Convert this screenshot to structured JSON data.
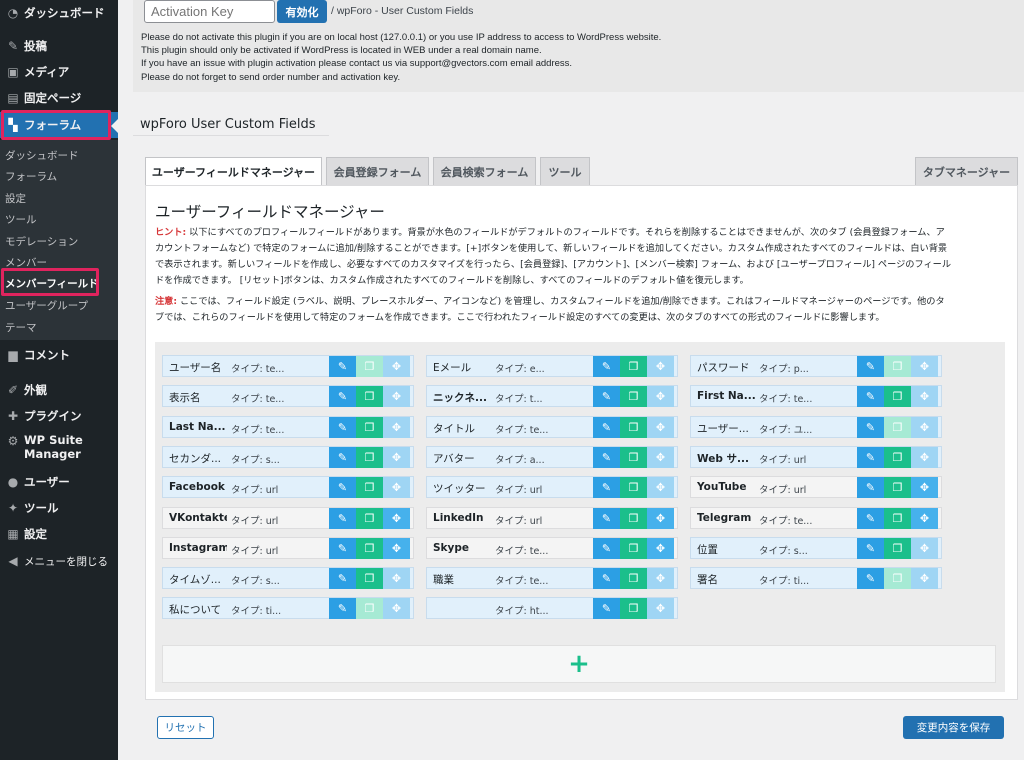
{
  "sidebar": {
    "menu": {
      "dashboard": "ダッシュボード",
      "posts": "投稿",
      "media": "メディア",
      "pages": "固定ページ",
      "forum": "フォーラム",
      "comments": "コメント",
      "appearance": "外観",
      "plugins": "プラグイン",
      "wp_suite_line1": "WP Suite",
      "wp_suite_line2": "Manager",
      "users": "ユーザー",
      "tools": "ツール",
      "settings": "設定",
      "collapse": "メニューを閉じる"
    },
    "submenu": {
      "dashboard": "ダッシュボード",
      "forums": "フォーラム",
      "settings": "設定",
      "tools": "ツール",
      "moderation": "モデレーション",
      "members": "メンバー",
      "member_fields": "メンバーフィールド",
      "usergroups": "ユーザーグループ",
      "themes": "テーマ"
    },
    "highlight_color": "#e0245e"
  },
  "notice": {
    "activation_placeholder": "Activation Key",
    "activate_label": "有効化",
    "plugin_name": "/ wpForo - User Custom Fields",
    "lines": [
      "Please do not activate this plugin if you are on local host (127.0.0.1) or you use IP address to access to WordPress website.",
      "This plugin should only be activated if WordPress is located in WEB under a real domain name.",
      "If you have an issue with plugin activation please contact us via support@gvectors.com email address.",
      "Please do not forget to send order number and activation key."
    ]
  },
  "page": {
    "heading": "wpForo User Custom Fields",
    "tabs": {
      "field_manager": "ユーザーフィールドマネージャー",
      "register_form": "会員登録フォーム",
      "search_form": "会員検索フォーム",
      "tools": "ツール",
      "tab_manager": "タブマネージャー"
    },
    "panel_title": "ユーザーフィールドマネージャー",
    "hint_lead": "ヒント:",
    "hint_lines": [
      "以下にすべてのプロフィールフィールドがあります。背景が水色のフィールドがデフォルトのフィールドです。それらを削除することはできませんが、次のタブ (会員登録フォーム、ア",
      "カウントフォームなど) で特定のフォームに追加/削除することができます。[+]ボタンを使用して、新しいフィールドを追加してください。カスタム作成されたすべてのフィールドは、白い背景",
      "で表示されます。新しいフィールドを作成し、必要なすべてのカスタマイズを行ったら、[会員登録]、[アカウント]、[メンバー検索] フォーム、および [ユーザープロフィール] ページのフィール",
      "ドを作成できます。 [リセット]ボタンは、カスタム作成されたすべてのフィールドを削除し、すべてのフィールドのデフォルト値を復元します。"
    ],
    "note_lead": "注意:",
    "note_lines": [
      "ここでは、フィールド設定 (ラベル、説明、プレースホルダー、アイコンなど) を管理し、カスタムフィールドを追加/削除できます。これはフィールドマネージャーのページです。他のタ",
      "ブでは、これらのフィールドを使用して特定のフォームを作成できます。ここで行われたフィールド設定のすべての変更は、次のタブのすべての形式のフィールドに影響します。"
    ],
    "fields": [
      [
        {
          "label": "ユーザー名",
          "type": "タイプ: te...",
          "dup": "light",
          "move": "light"
        },
        {
          "label": "表示名",
          "type": "タイプ: te...",
          "dup": "normal",
          "move": "light"
        },
        {
          "label": "Last Na...",
          "type": "タイプ: te...",
          "dup": "normal",
          "move": "light",
          "bold": true
        },
        {
          "label": "セカンダ...",
          "type": "タイプ: s...",
          "dup": "normal",
          "move": "light"
        },
        {
          "label": "Facebook",
          "type": "タイプ: url",
          "dup": "normal",
          "move": "light",
          "bold": true
        },
        {
          "label": "VKontakte",
          "type": "タイプ: url",
          "dup": "normal",
          "move": "normal",
          "bold": true,
          "custom": true
        },
        {
          "label": "Instagram",
          "type": "タイプ: url",
          "dup": "normal",
          "move": "normal",
          "bold": true,
          "custom": true
        },
        {
          "label": "タイムゾ...",
          "type": "タイプ: s...",
          "dup": "normal",
          "move": "light"
        },
        {
          "label": "私について",
          "type": "タイプ: ti...",
          "dup": "light",
          "move": "light"
        }
      ],
      [
        {
          "label": "Eメール",
          "type": "タイプ: e...",
          "dup": "normal",
          "move": "light"
        },
        {
          "label": "ニックネ...",
          "type": "タイプ: t...",
          "dup": "normal",
          "move": "light",
          "bold": true
        },
        {
          "label": "タイトル",
          "type": "タイプ: te...",
          "dup": "normal",
          "move": "light"
        },
        {
          "label": "アバター",
          "type": "タイプ: a...",
          "dup": "normal",
          "move": "light"
        },
        {
          "label": "ツイッター",
          "type": "タイプ: url",
          "dup": "normal",
          "move": "light"
        },
        {
          "label": "LinkedIn",
          "type": "タイプ: url",
          "dup": "normal",
          "move": "normal",
          "bold": true,
          "custom": true
        },
        {
          "label": "Skype",
          "type": "タイプ: te...",
          "dup": "normal",
          "move": "normal",
          "bold": true,
          "custom": true
        },
        {
          "label": "職業",
          "type": "タイプ: te...",
          "dup": "normal",
          "move": "light"
        },
        {
          "label": "",
          "type": "タイプ: ht...",
          "dup": "normal",
          "move": "light"
        }
      ],
      [
        {
          "label": "パスワード",
          "type": "タイプ: p...",
          "dup": "light",
          "move": "light"
        },
        {
          "label": "First Na...",
          "type": "タイプ: te...",
          "dup": "normal",
          "move": "light",
          "bold": true
        },
        {
          "label": "ユーザー...",
          "type": "タイプ: ユ...",
          "dup": "light",
          "move": "light"
        },
        {
          "label": "Web サ...",
          "type": "タイプ: url",
          "dup": "normal",
          "move": "light",
          "bold": true
        },
        {
          "label": "YouTube",
          "type": "タイプ: url",
          "dup": "normal",
          "move": "normal",
          "bold": true,
          "custom": true
        },
        {
          "label": "Telegram",
          "type": "タイプ: te...",
          "dup": "normal",
          "move": "normal",
          "bold": true,
          "custom": true
        },
        {
          "label": "位置",
          "type": "タイプ: s...",
          "dup": "normal",
          "move": "light"
        },
        {
          "label": "署名",
          "type": "タイプ: ti...",
          "dup": "light",
          "move": "light"
        }
      ]
    ],
    "add_symbol": "+",
    "reset_label": "リセット",
    "save_label": "変更内容を保存"
  },
  "colors": {
    "admin_bar": "#1d2327",
    "accent": "#2271b1",
    "edit": "#2c9fe4",
    "duplicate": "#1bbf8b",
    "move": "#46b1ec",
    "default_field_bg": "#e1f0fb"
  },
  "icons": {
    "edit": "pencil-icon",
    "duplicate": "copy-icon",
    "move": "move-arrows-icon",
    "add": "plus-icon"
  }
}
